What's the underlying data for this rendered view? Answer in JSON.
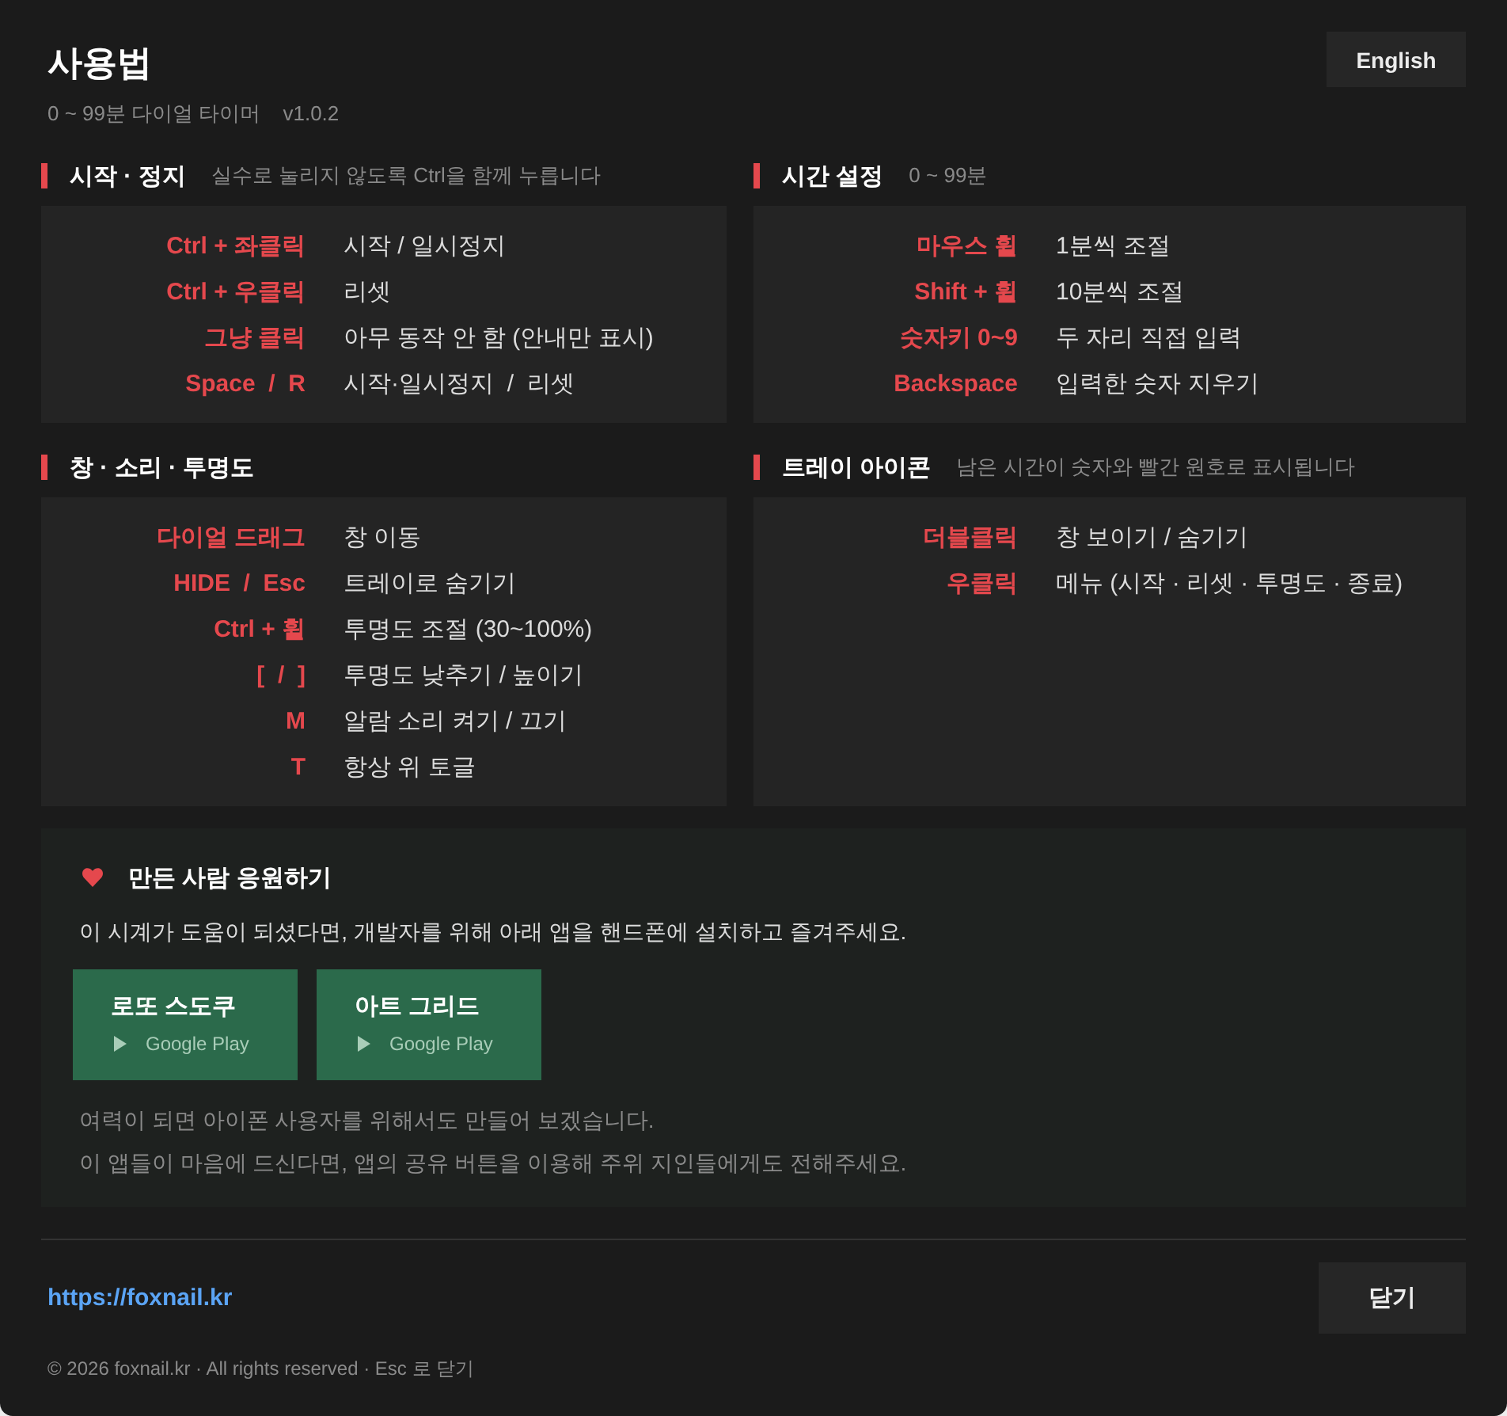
{
  "header": {
    "title": "사용법",
    "subtitle": "0 ~ 99분 다이얼 타이머",
    "version": "v1.0.2",
    "language_button": "English"
  },
  "sections": [
    {
      "title": "시작 · 정지",
      "hint": "실수로 눌리지 않도록 Ctrl을 함께 누릅니다",
      "shortcuts": [
        {
          "key": "Ctrl + 좌클릭",
          "action": "시작 / 일시정지"
        },
        {
          "key": "Ctrl + 우클릭",
          "action": "리셋"
        },
        {
          "key": "그냥 클릭",
          "action": "아무 동작 안 함 (안내만 표시)"
        },
        {
          "key": "Space  /  R",
          "action": "시작·일시정지  /  리셋"
        }
      ]
    },
    {
      "title": "시간 설정",
      "hint": "0 ~ 99분",
      "shortcuts": [
        {
          "key": "마우스 휠",
          "action": "1분씩 조절"
        },
        {
          "key": "Shift + 휠",
          "action": "10분씩 조절"
        },
        {
          "key": "숫자키 0~9",
          "action": "두 자리 직접 입력"
        },
        {
          "key": "Backspace",
          "action": "입력한 숫자 지우기"
        }
      ]
    },
    {
      "title": "창 · 소리 · 투명도",
      "shortcuts": [
        {
          "key": "다이얼 드래그",
          "action": "창 이동"
        },
        {
          "key": "HIDE  /  Esc",
          "action": "트레이로 숨기기"
        },
        {
          "key": "Ctrl + 휠",
          "action": "투명도 조절 (30~100%)"
        },
        {
          "key": "[  /  ]",
          "action": "투명도 낮추기 / 높이기"
        },
        {
          "key": "M",
          "action": "알람 소리 켜기 / 끄기"
        },
        {
          "key": "T",
          "action": "항상 위 토글"
        }
      ]
    },
    {
      "title": "트레이 아이콘",
      "hint": "남은 시간이 숫자와 빨간 원호로 표시됩니다",
      "shortcuts": [
        {
          "key": "더블클릭",
          "action": "창 보이기 / 숨기기"
        },
        {
          "key": "우클릭",
          "action": "메뉴 (시작 · 리셋 · 투명도 · 종료)"
        }
      ]
    }
  ],
  "support": {
    "title": "만든 사람 응원하기",
    "text": "이 시계가 도움이 되셨다면, 개발자를 위해 아래 앱을 핸드폰에 설치하고 즐겨주세요.",
    "apps": [
      {
        "name": "로또 스도쿠",
        "store": "Google Play"
      },
      {
        "name": "아트 그리드",
        "store": "Google Play"
      }
    ],
    "notes": [
      "여력이 되면 아이폰 사용자를 위해서도 만들어 보겠습니다.",
      "이 앱들이 마음에 드신다면, 앱의 공유 버튼을 이용해 주위 지인들에게도 전해주세요."
    ]
  },
  "footer": {
    "link": "https://foxnail.kr",
    "close_button": "닫기",
    "copyright": "© 2026 foxnail.kr · All rights reserved · Esc 로 닫기"
  }
}
